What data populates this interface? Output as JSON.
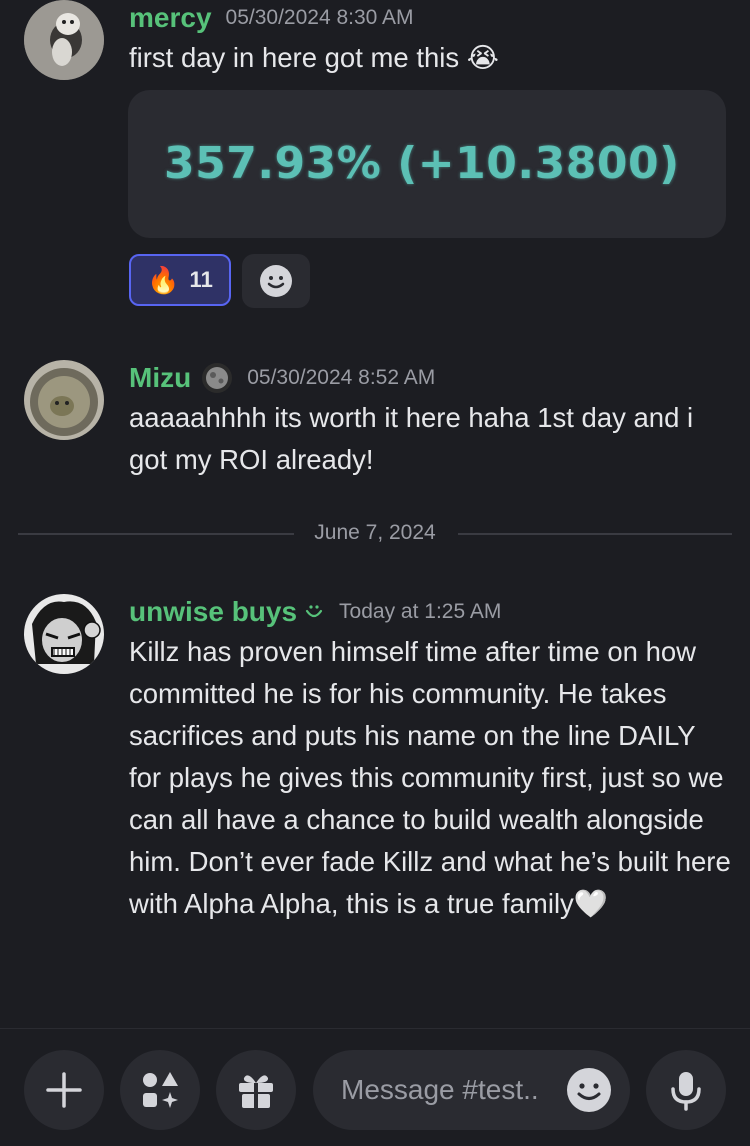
{
  "messages": [
    {
      "author": "mercy",
      "author_color": "#57c27a",
      "timestamp": "05/30/2024 8:30 AM",
      "text": "first day in here got me this 😭",
      "attachment": {
        "value_text": "357.93%  (+10.3800)"
      },
      "reactions": [
        {
          "emoji": "🔥",
          "count": "11"
        }
      ]
    },
    {
      "author": "Mizu",
      "author_color": "#57c27a",
      "timestamp": "05/30/2024 8:52 AM",
      "text": "aaaaahhhh its worth it here haha 1st day and i got my ROI already!"
    },
    {
      "author": "unwise buys",
      "author_color": "#57c27a",
      "timestamp": "Today at 1:25 AM",
      "text": "Killz has proven himself time after time on how committed he is for his community. He takes sacrifices and puts his name on the line DAILY for plays he gives this community first, just so we can all have a chance to build wealth alongside him. Don’t ever fade Killz and what he’s built here with Alpha Alpha, this is a true family🤍"
    }
  ],
  "date_divider": "June 7, 2024",
  "composer": {
    "placeholder": "Message #test.."
  }
}
